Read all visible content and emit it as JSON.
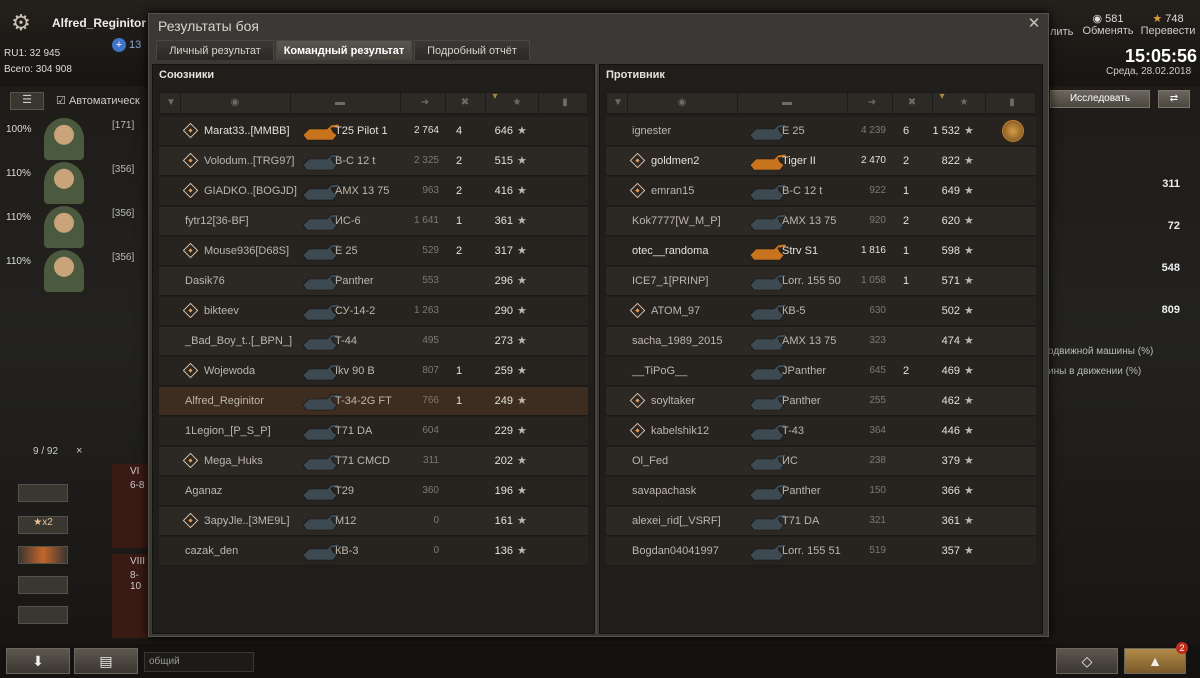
{
  "player": {
    "name": "Alfred_Reginitor",
    "level": "13",
    "rating": "RU1: 32 945",
    "total": "Всего: 304 908"
  },
  "topright": {
    "credits": "581",
    "exchange": "Обменять",
    "gold": "748",
    "transfer": "Перевести",
    "partial": "лить"
  },
  "time": "15:05:56",
  "date": "Среда, 28.02.2018",
  "garage": {
    "auto": "Автоматическ",
    "research": "Исследовать",
    "crew": [
      {
        "pct": "100%",
        "code": "[171]"
      },
      {
        "pct": "110%",
        "code": "[356]"
      },
      {
        "pct": "110%",
        "code": "[356]"
      },
      {
        "pct": "110%",
        "code": "[356]"
      }
    ],
    "carousel": "9 / 92",
    "close": "×",
    "tier6": "VI",
    "range6": "6-8",
    "tier8": "VIII",
    "range8": "8-10",
    "chat": "общий",
    "notif": "2",
    "rvals": [
      "311",
      "72",
      "548",
      "809"
    ],
    "rtexts": [
      "одвижной машины (%)",
      "ины в движении (%)"
    ]
  },
  "dialog": {
    "title": "Результаты боя",
    "close": "✕",
    "tabs": [
      "Личный результат",
      "Командный результат",
      "Подробный отчёт"
    ],
    "allies": "Союзники",
    "enemies": "Противник"
  },
  "allies": [
    {
      "name": "Marat33..[MMBB]",
      "rank": true,
      "tank": "T25 Pilot 1",
      "dmg": "2 764",
      "frags": "4",
      "xp": "646",
      "hl": true
    },
    {
      "name": "Volodum..[TRG97]",
      "rank": true,
      "tank": "В-С 12 t",
      "dmg": "2 325",
      "frags": "2",
      "xp": "515",
      "hl": false
    },
    {
      "name": "GIADKO..[BOGJD]",
      "rank": true,
      "tank": "AMX 13 75",
      "dmg": "963",
      "frags": "2",
      "xp": "416",
      "hl": false
    },
    {
      "name": "fytr12[36-BF]",
      "rank": false,
      "tank": "ИС-6",
      "dmg": "1 641",
      "frags": "1",
      "xp": "361",
      "hl": false
    },
    {
      "name": "Mouse936[D68S]",
      "rank": true,
      "tank": "E 25",
      "dmg": "529",
      "frags": "2",
      "xp": "317",
      "hl": false
    },
    {
      "name": "Dasik76",
      "rank": false,
      "tank": "Panther",
      "dmg": "553",
      "frags": "",
      "xp": "296",
      "hl": false
    },
    {
      "name": "bikteev",
      "rank": true,
      "tank": "СУ-14-2",
      "dmg": "1 263",
      "frags": "",
      "xp": "290",
      "hl": false
    },
    {
      "name": "_Bad_Boy_t..[_BPN_]",
      "rank": false,
      "tank": "T-44",
      "dmg": "495",
      "frags": "",
      "xp": "273",
      "hl": false
    },
    {
      "name": "Wojewoda",
      "rank": true,
      "tank": "Ikv 90 B",
      "dmg": "807",
      "frags": "1",
      "xp": "259",
      "hl": false
    },
    {
      "name": "Alfred_Reginitor",
      "rank": false,
      "tank": "T-34-2G FT",
      "dmg": "766",
      "frags": "1",
      "xp": "249",
      "hl": false,
      "me": true
    },
    {
      "name": "1Legion_[P_S_P]",
      "rank": false,
      "tank": "T71 DA",
      "dmg": "604",
      "frags": "",
      "xp": "229",
      "hl": false
    },
    {
      "name": "Mega_Huks",
      "rank": true,
      "tank": "T71 CMCD",
      "dmg": "311",
      "frags": "",
      "xp": "202",
      "hl": false
    },
    {
      "name": "Aganaz",
      "rank": false,
      "tank": "T29",
      "dmg": "360",
      "frags": "",
      "xp": "196",
      "hl": false
    },
    {
      "name": "ЗapyJle..[3ME9L]",
      "rank": true,
      "tank": "M12",
      "dmg": "0",
      "frags": "",
      "xp": "161",
      "hl": false
    },
    {
      "name": "cazak_den",
      "rank": false,
      "tank": "КВ-3",
      "dmg": "0",
      "frags": "",
      "xp": "136",
      "hl": false
    }
  ],
  "enemies": [
    {
      "name": "ignester",
      "rank": false,
      "tank": "E 25",
      "dmg": "4 239",
      "frags": "6",
      "xp": "1 532",
      "hl": false,
      "medal": true
    },
    {
      "name": "goldmen2",
      "rank": true,
      "tank": "Tiger II",
      "dmg": "2 470",
      "frags": "2",
      "xp": "822",
      "hl": true
    },
    {
      "name": "emran15",
      "rank": true,
      "tank": "В-С 12 t",
      "dmg": "922",
      "frags": "1",
      "xp": "649",
      "hl": false
    },
    {
      "name": "Kok7777[W_M_P]",
      "rank": false,
      "tank": "AMX 13 75",
      "dmg": "920",
      "frags": "2",
      "xp": "620",
      "hl": false
    },
    {
      "name": "otec__randoma",
      "rank": false,
      "tank": "Strv S1",
      "dmg": "1 816",
      "frags": "1",
      "xp": "598",
      "hl": true
    },
    {
      "name": "ICE7_1[PRINP]",
      "rank": false,
      "tank": "Lorr. 155 50",
      "dmg": "1 058",
      "frags": "1",
      "xp": "571",
      "hl": false
    },
    {
      "name": "ATOM_97",
      "rank": true,
      "tank": "КВ-5",
      "dmg": "630",
      "frags": "",
      "xp": "502",
      "hl": false
    },
    {
      "name": "sacha_1989_2015",
      "rank": false,
      "tank": "AMX 13 75",
      "dmg": "323",
      "frags": "",
      "xp": "474",
      "hl": false
    },
    {
      "name": "__TiPoG__",
      "rank": false,
      "tank": "JPanther",
      "dmg": "645",
      "frags": "2",
      "xp": "469",
      "hl": false
    },
    {
      "name": "soyltaker",
      "rank": true,
      "tank": "Panther",
      "dmg": "255",
      "frags": "",
      "xp": "462",
      "hl": false
    },
    {
      "name": "kabelshik12",
      "rank": true,
      "tank": "T-43",
      "dmg": "364",
      "frags": "",
      "xp": "446",
      "hl": false
    },
    {
      "name": "Ol_Fed",
      "rank": false,
      "tank": "ИС",
      "dmg": "238",
      "frags": "",
      "xp": "379",
      "hl": false
    },
    {
      "name": "savapachask",
      "rank": false,
      "tank": "Panther",
      "dmg": "150",
      "frags": "",
      "xp": "366",
      "hl": false
    },
    {
      "name": "alexei_rid[_VSRF]",
      "rank": false,
      "tank": "T71 DA",
      "dmg": "321",
      "frags": "",
      "xp": "361",
      "hl": false
    },
    {
      "name": "Bogdan04041997",
      "rank": false,
      "tank": "Lorr. 155 51",
      "dmg": "519",
      "frags": "",
      "xp": "357",
      "hl": false
    }
  ],
  "star": "★"
}
